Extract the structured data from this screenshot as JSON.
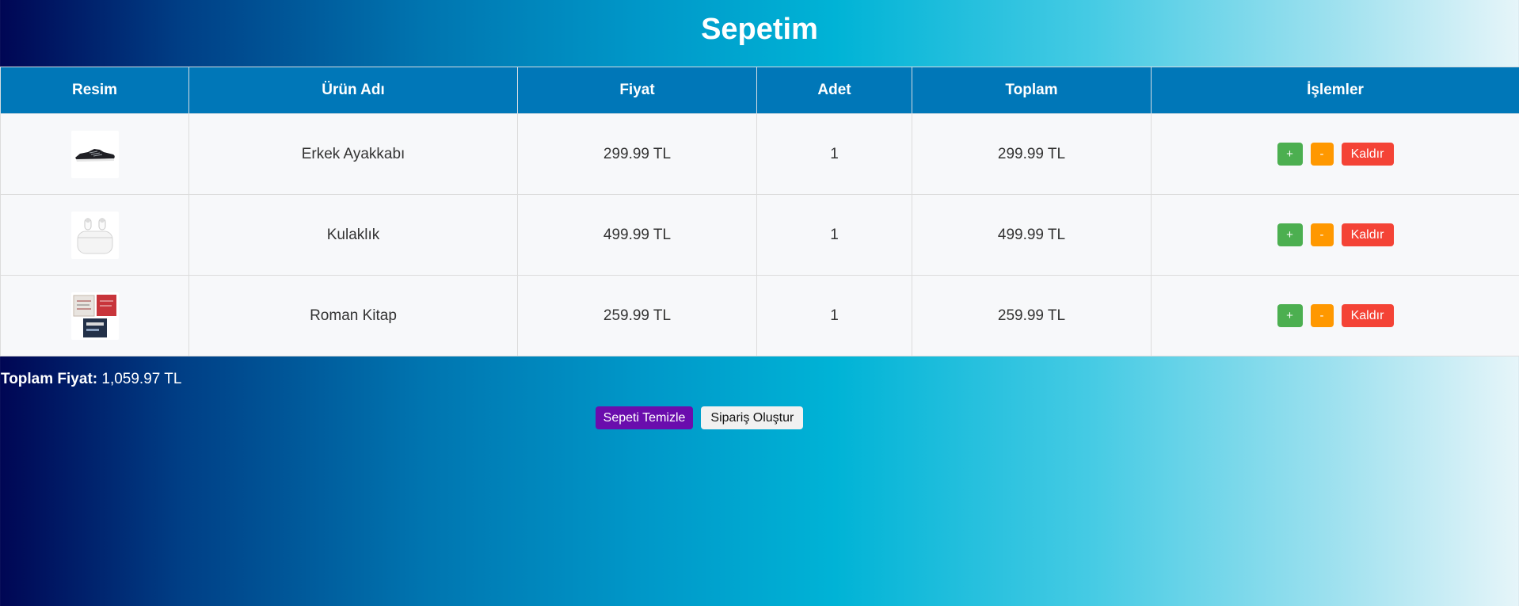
{
  "page": {
    "title": "Sepetim"
  },
  "table": {
    "headers": [
      "Resim",
      "Ürün Adı",
      "Fiyat",
      "Adet",
      "Toplam",
      "İşlemler"
    ],
    "rows": [
      {
        "image_icon": "shoe-icon",
        "name": "Erkek Ayakkabı",
        "price": "299.99 TL",
        "qty": "1",
        "total": "299.99 TL"
      },
      {
        "image_icon": "earbuds-icon",
        "name": "Kulaklık",
        "price": "499.99 TL",
        "qty": "1",
        "total": "499.99 TL"
      },
      {
        "image_icon": "books-icon",
        "name": "Roman Kitap",
        "price": "259.99 TL",
        "qty": "1",
        "total": "259.99 TL"
      }
    ],
    "actions": {
      "plus_label": "+",
      "minus_label": "-",
      "remove_label": "Kaldır"
    }
  },
  "summary": {
    "total_label": "Toplam Fiyat:",
    "total_value": "1,059.97 TL"
  },
  "footer": {
    "clear_label": "Sepeti Temizle",
    "order_label": "Sipariş Oluştur"
  },
  "colors": {
    "header_bg": "#0077b8",
    "plus": "#4caf50",
    "minus": "#ff9800",
    "remove": "#f44336",
    "clear": "#6a0dad"
  }
}
